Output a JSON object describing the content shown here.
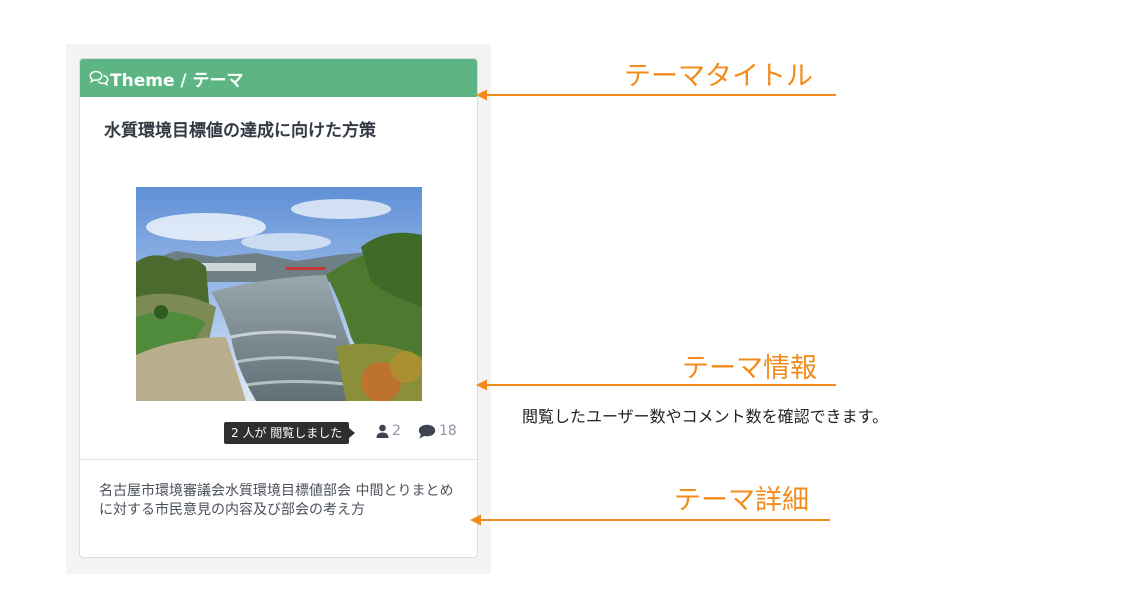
{
  "card": {
    "header": {
      "title": "Theme / テーマ",
      "icon": "comments-icon",
      "color": "#5cb583"
    },
    "theme_title": "水質環境目標値の達成に向けた方策",
    "image": {
      "subject": "river-landscape-photo"
    },
    "tooltip": "2 人が 閲覧しました",
    "stats": {
      "users": "2",
      "comments": "18",
      "users_icon": "user-icon",
      "comments_icon": "comment-icon"
    },
    "detail": "名古屋市環境審議会水質環境目標値部会 中間とりまとめに対する市民意見の内容及び部会の考え方"
  },
  "annotations": {
    "title_label": "テーマタイトル",
    "info_label": "テーマ情報",
    "info_note": "閲覧したユーザー数やコメント数を確認できます。",
    "detail_label": "テーマ詳細",
    "accent_color": "#f28c1d"
  }
}
